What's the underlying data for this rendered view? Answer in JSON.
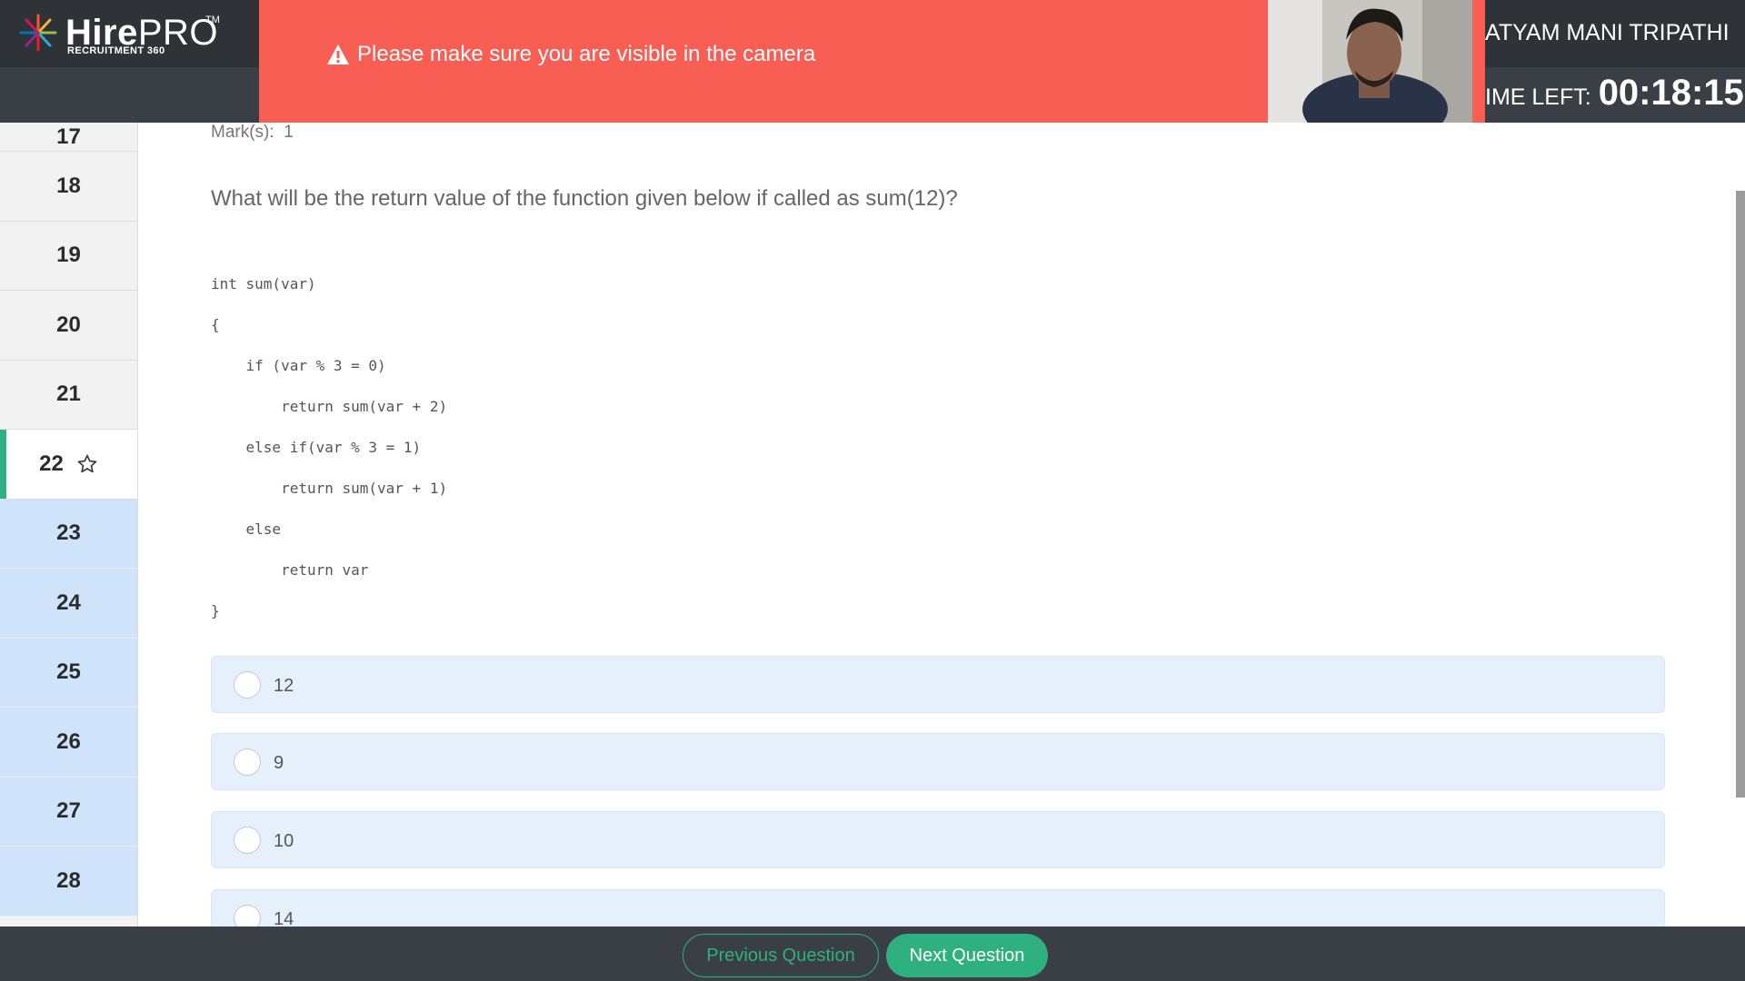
{
  "header": {
    "logo_text_bold": "Hire",
    "logo_text_light": "PRO",
    "logo_tm": "TM",
    "logo_sub": "RECRUITMENT 360",
    "alert_message": "Please make sure you are visible in the camera",
    "candidate_name": "ATYAM MANI TRIPATHI",
    "time_left_label": "IME LEFT:",
    "time_left_value": "00:18:15"
  },
  "sidebar": {
    "items": [
      {
        "number": "17",
        "state": "visited"
      },
      {
        "number": "18",
        "state": "visited"
      },
      {
        "number": "19",
        "state": "visited"
      },
      {
        "number": "20",
        "state": "visited"
      },
      {
        "number": "21",
        "state": "visited"
      },
      {
        "number": "22",
        "state": "active"
      },
      {
        "number": "23",
        "state": "unvisited"
      },
      {
        "number": "24",
        "state": "unvisited"
      },
      {
        "number": "25",
        "state": "unvisited"
      },
      {
        "number": "26",
        "state": "unvisited"
      },
      {
        "number": "27",
        "state": "unvisited"
      },
      {
        "number": "28",
        "state": "unvisited"
      }
    ]
  },
  "question": {
    "marks_label": "Mark(s):",
    "marks_value": "1",
    "text": "What will be the return value of the function given below if called as sum(12)?",
    "code_lines": [
      "int sum(var)",
      "{",
      "    if (var % 3 = 0)",
      "        return sum(var + 2)",
      "    else if(var % 3 = 1)",
      "        return sum(var + 1)",
      "    else",
      "        return var",
      "}"
    ],
    "options": [
      "12",
      "9",
      "10",
      "14"
    ]
  },
  "footer": {
    "prev_label": "Previous Question",
    "next_label": "Next Question"
  },
  "colors": {
    "accent_green": "#2fb07f",
    "alert_red": "#f95e54",
    "dark_bar": "#3a3f45",
    "unvisited_blue": "#cfe4fb"
  }
}
